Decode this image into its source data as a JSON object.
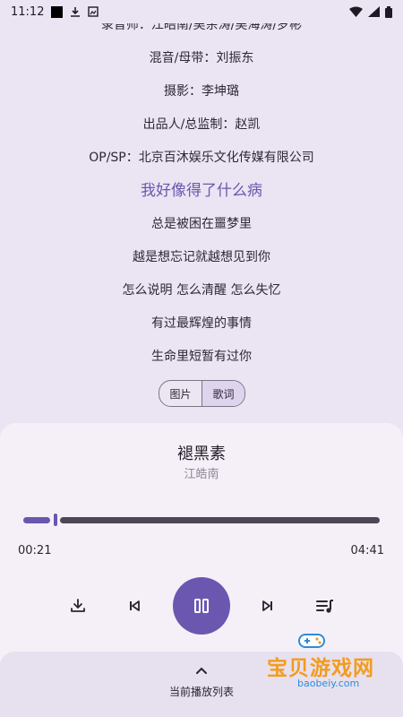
{
  "status_bar": {
    "time": "11:12"
  },
  "lyrics": [
    "录音师：江皓南/吴余涛/吴海涛/罗彬",
    "混音/母带：刘振东",
    "摄影：李坤璐",
    "出品人/总监制：赵凯",
    "OP/SP：北京百沐娱乐文化传媒有限公司",
    "我好像得了什么病",
    "总是被困在噩梦里",
    "越是想忘记就越想见到你",
    "怎么说明 怎么清醒 怎么失忆",
    "有过最辉煌的事情",
    "生命里短暂有过你"
  ],
  "active_lyric_index": 5,
  "view_toggle": {
    "image_label": "图片",
    "lyrics_label": "歌词",
    "selected": "lyrics"
  },
  "player": {
    "title": "褪黑素",
    "artist": "江皓南",
    "current_time": "00:21",
    "total_time": "04:41",
    "progress_fraction": 0.075
  },
  "bottom": {
    "playlist_label": "当前播放列表"
  },
  "watermark": {
    "brand": "宝贝游戏网",
    "url": "baobeiy.com"
  },
  "colors": {
    "accent": "#6b57b0",
    "background": "#ebe4f2",
    "panel": "#f5f0f8"
  }
}
